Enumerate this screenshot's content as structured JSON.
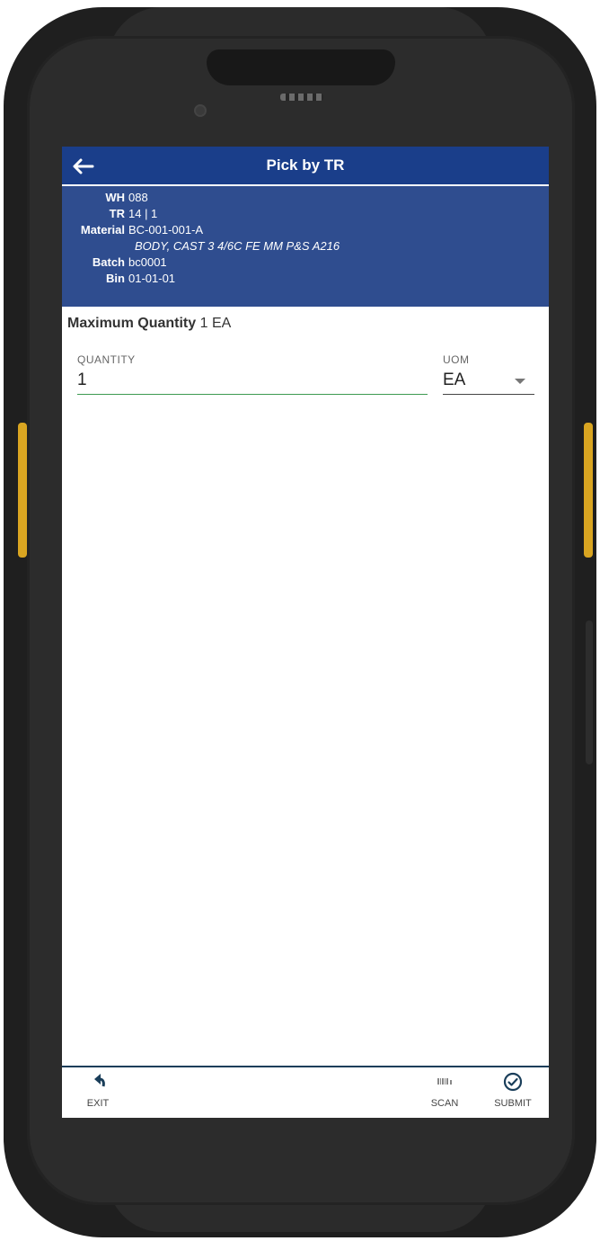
{
  "header": {
    "title": "Pick by TR"
  },
  "info": {
    "wh_label": "WH",
    "wh_value": "088",
    "tr_label": "TR",
    "tr_value": "14 | 1",
    "material_label": "Material",
    "material_value": "BC-001-001-A",
    "material_desc": "BODY, CAST 3 4/6C FE MM P&S A216",
    "batch_label": "Batch",
    "batch_value": "bc0001",
    "bin_label": "Bin",
    "bin_value": "01-01-01"
  },
  "max_quantity": {
    "label": "Maximum Quantity",
    "value": "1 EA"
  },
  "form": {
    "quantity_label": "QUANTITY",
    "quantity_value": "1",
    "uom_label": "UOM",
    "uom_value": "EA"
  },
  "toolbar": {
    "exit_label": "EXIT",
    "scan_label": "SCAN",
    "submit_label": "SUBMIT"
  },
  "colors": {
    "title_bar": "#1a3e8a",
    "info_panel": "#2f4d8f",
    "input_underline": "#3d9a52",
    "side_keys": "#d9a521"
  }
}
